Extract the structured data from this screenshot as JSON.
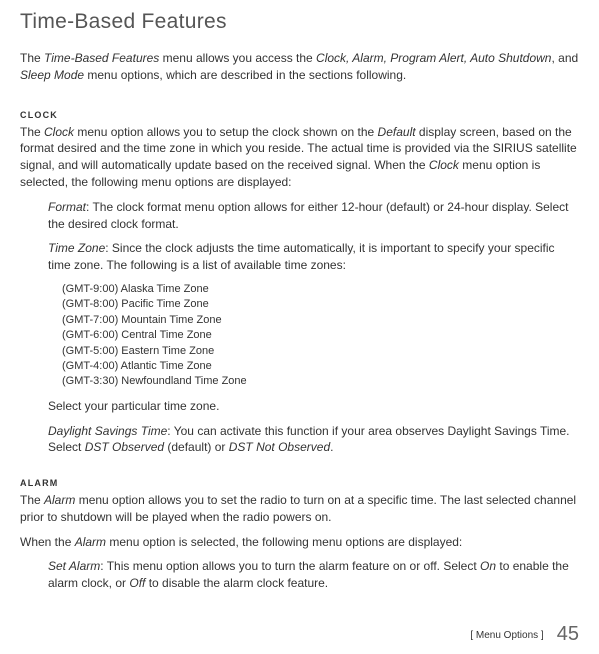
{
  "title": "Time-Based Features",
  "intro_html": "The <em>Time-Based Features</em> menu allows you access the <em>Clock, Alarm, Program Alert, Auto Shutdown</em>, and <em>Sleep Mode</em> menu options, which are described in the sections following.",
  "clock": {
    "label": "CLOCK",
    "p1_html": "The <em>Clock</em> menu option allows you to setup the clock shown on the <em>Default</em> display screen, based on the format desired and the time zone in which you reside. The actual time is provided via the SIRIUS satellite signal, and will automatically update based on the received signal. When the <em>Clock</em> menu option is selected, the following menu options are displayed:",
    "format_html": "<em>Format</em>: The clock format menu option allows for either 12-hour (default) or 24-hour display. Select the desired clock format.",
    "timezone_html": "<em>Time Zone</em>: Since the clock adjusts the time automatically, it is important to specify your specific time zone. The following is a list of available time zones:",
    "tz_list": [
      "(GMT-9:00) Alaska Time Zone",
      "(GMT-8:00) Pacific Time Zone",
      "(GMT-7:00) Mountain Time Zone",
      "(GMT-6:00) Central Time Zone",
      "(GMT-5:00) Eastern Time Zone",
      "(GMT-4:00) Atlantic Time Zone",
      "(GMT-3:30) Newfoundland Time Zone"
    ],
    "select_tz": "Select your particular time zone.",
    "dst_html": "<em>Daylight Savings Time</em>: You can activate this function if your area observes Daylight Savings Time. Select <em>DST Observed</em> (default) or <em>DST Not Observed</em>."
  },
  "alarm": {
    "label": "ALARM",
    "p1_html": "The <em>Alarm</em> menu option allows you to set the radio to turn on at a specific time. The last selected channel prior to shutdown will be played when the radio powers on.",
    "p2_html": "When the <em>Alarm</em> menu option is selected, the following menu options are displayed:",
    "set_alarm_html": "<em>Set Alarm</em>: This menu option allows you to turn the alarm feature on or off. Select <em>On</em> to enable the alarm clock, or <em>Off</em> to disable the alarm clock feature."
  },
  "footer": {
    "section": "[ Menu Options ]",
    "page": "45"
  }
}
